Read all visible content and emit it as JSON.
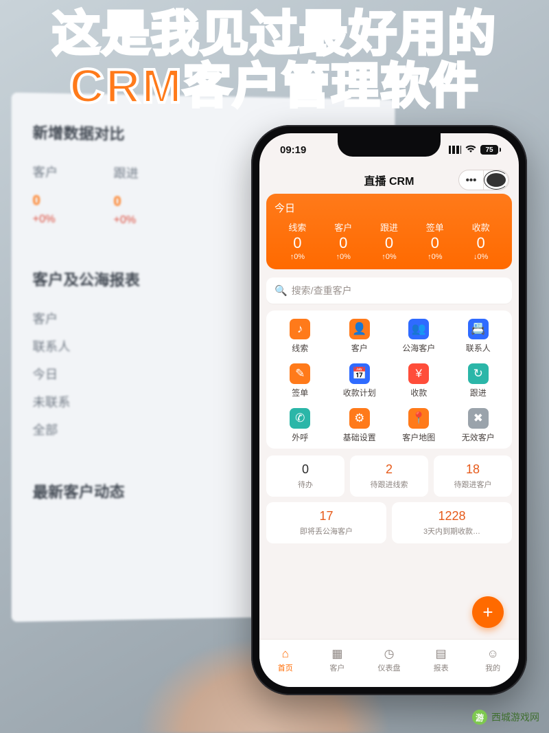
{
  "caption_line1": "这是我见过最好用的",
  "caption_line2": "CRM客户管理软件",
  "monitor": {
    "section1_title": "新增数据对比",
    "cols": [
      {
        "head": "客户",
        "val": "0",
        "delta": "+0%"
      },
      {
        "head": "跟进",
        "val": "0",
        "delta": "+0%"
      }
    ],
    "section2_title": "客户及公海报表",
    "list": [
      "客户",
      "联系人",
      "今日",
      "未联系",
      "全部"
    ],
    "section3_title": "最新客户动态"
  },
  "status": {
    "time": "09:19",
    "battery": "75"
  },
  "title": "直播 CRM",
  "dash": {
    "title": "今日",
    "cells": [
      {
        "label": "线索",
        "val": "0",
        "arrow": "↑",
        "delta": "0%"
      },
      {
        "label": "客户",
        "val": "0",
        "arrow": "↑",
        "delta": "0%"
      },
      {
        "label": "跟进",
        "val": "0",
        "arrow": "↑",
        "delta": "0%"
      },
      {
        "label": "签单",
        "val": "0",
        "arrow": "↑",
        "delta": "0%"
      },
      {
        "label": "收款",
        "val": "0",
        "arrow": "↓",
        "delta": "0%"
      }
    ]
  },
  "search_placeholder": "搜索/查重客户",
  "apps": [
    {
      "label": "线索",
      "bg": "#ff7a1a",
      "glyph": "♪"
    },
    {
      "label": "客户",
      "bg": "#ff7a1a",
      "glyph": "👤"
    },
    {
      "label": "公海客户",
      "bg": "#2f6bff",
      "glyph": "👥"
    },
    {
      "label": "联系人",
      "bg": "#2f6bff",
      "glyph": "📇"
    },
    {
      "label": "签单",
      "bg": "#ff7a1a",
      "glyph": "✎"
    },
    {
      "label": "收款计划",
      "bg": "#2f6bff",
      "glyph": "📅"
    },
    {
      "label": "收款",
      "bg": "#ff4d3a",
      "glyph": "¥"
    },
    {
      "label": "跟进",
      "bg": "#2bb6a8",
      "glyph": "↻"
    },
    {
      "label": "外呼",
      "bg": "#2bb6a8",
      "glyph": "✆"
    },
    {
      "label": "基础设置",
      "bg": "#ff7a1a",
      "glyph": "⚙"
    },
    {
      "label": "客户地图",
      "bg": "#ff7a1a",
      "glyph": "📍"
    },
    {
      "label": "无效客户",
      "bg": "#9aa3ab",
      "glyph": "✖"
    }
  ],
  "todos": [
    {
      "num": "0",
      "label": "待办",
      "hot": false
    },
    {
      "num": "2",
      "label": "待跟进线索",
      "hot": true
    },
    {
      "num": "18",
      "label": "待跟进客户",
      "hot": true
    },
    {
      "num": "17",
      "label": "即将丢公海客户",
      "hot": true
    },
    {
      "num": "1228",
      "label": "3天内到期收款…",
      "hot": true
    }
  ],
  "fab": "+",
  "tabs": [
    {
      "label": "首页",
      "glyph": "⌂",
      "active": true
    },
    {
      "label": "客户",
      "glyph": "▦",
      "active": false
    },
    {
      "label": "仪表盘",
      "glyph": "◷",
      "active": false
    },
    {
      "label": "报表",
      "glyph": "▤",
      "active": false
    },
    {
      "label": "我的",
      "glyph": "☺",
      "active": false
    }
  ],
  "watermark": "西城游戏网"
}
